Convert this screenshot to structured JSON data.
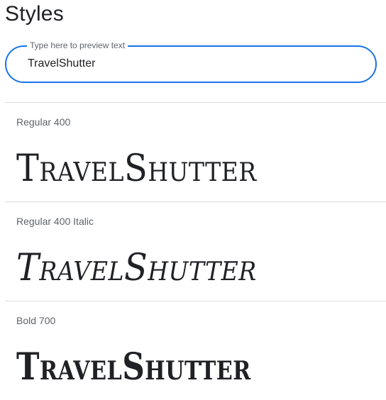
{
  "page": {
    "title": "Styles"
  },
  "preview": {
    "label": "Type here to preview text",
    "value": "TravelShutter"
  },
  "styles": [
    {
      "name": "Regular 400",
      "sample": "TravelShutter"
    },
    {
      "name": "Regular 400 Italic",
      "sample": "TravelShutter"
    },
    {
      "name": "Bold 700",
      "sample": "TravelShutter"
    }
  ]
}
